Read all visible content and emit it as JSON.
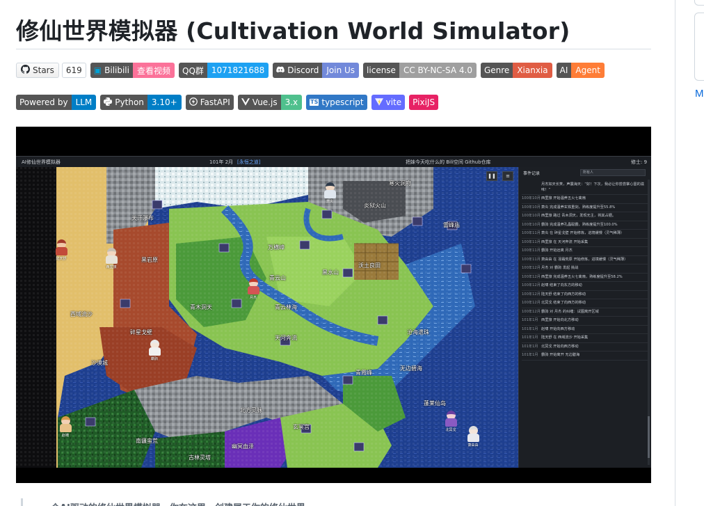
{
  "page": {
    "title": "修仙世界模拟器 (Cultivation World Simulator)",
    "sidebar_letter": "M",
    "quote_text": "一个AI驱动的修仙世界模拟器，你在这里，创建属于你的修仙世界"
  },
  "badges_row1": [
    {
      "type": "stars",
      "icon": "github-icon",
      "label": "Stars",
      "value": "619"
    },
    {
      "icon": "bilibili-icon",
      "label": "Bilibili",
      "value": "查看视频",
      "color": "#fb7299"
    },
    {
      "icon": "",
      "label": "QQ群",
      "value": "1071821688",
      "color": "#1da1f2"
    },
    {
      "icon": "discord-icon",
      "label": "Discord",
      "value": "Join Us",
      "color": "#7289da"
    },
    {
      "icon": "",
      "label": "license",
      "value": "CC BY-NC-SA 4.0",
      "color": "#9f9f9f"
    },
    {
      "icon": "",
      "label": "Genre",
      "value": "Xianxia",
      "color": "#e05d44"
    },
    {
      "icon": "",
      "label": "AI",
      "value": "Agent",
      "color": "#fe7d37"
    }
  ],
  "badges_row2": [
    {
      "icon": "",
      "label": "Powered by",
      "value": "LLM",
      "color": "#007ec6"
    },
    {
      "icon": "python-icon",
      "label": "Python",
      "value": "3.10+",
      "color": "#007ec6"
    },
    {
      "icon": "fastapi-icon",
      "label": "FastAPI",
      "value": "",
      "color": "#555555"
    },
    {
      "icon": "vue-icon",
      "label": "Vue.js",
      "value": "3.x",
      "color": "#4fc08d"
    },
    {
      "icon": "typescript-icon",
      "label": "typescript",
      "value": "",
      "color": "#3178c6"
    },
    {
      "icon": "vite-icon",
      "label": "vite",
      "value": "",
      "color": "#646cff"
    },
    {
      "icon": "",
      "label": "PixiJS",
      "value": "",
      "color": "#e72264"
    }
  ],
  "game": {
    "app_title": "AI修仙世界模拟器",
    "date": "101年 2月",
    "status": "[永恒之道]",
    "center_links": "把妹今天吃什么的 Bili空间 Github仓库",
    "right_count": "修士: 9",
    "panel_title": "事件记录",
    "panel_filter": "所有人",
    "log": [
      {
        "t": "",
        "m": "月杰如天长笑，声震海天：“好！下次，我必让你尝尝掌心雷的滋味！”"
      },
      {
        "t": "100年10月",
        "m": "西里旅 开始温养五火七禽扇"
      },
      {
        "t": "100年10月",
        "m": "萧炎 完成温养玄铁重剑，熟练度提升至55.8%"
      },
      {
        "t": "100年10月",
        "m": "西里旅 路过 青木洞天，发现无主，将其占据。"
      },
      {
        "t": "100年10月",
        "m": "霸驹 完成温养孔晶聪霸，熟练度提升至100.0%"
      },
      {
        "t": "100年11月",
        "m": "萧炎 在 碎星戈壁 开始修炼，进境缓慢（灵气稀薄）"
      },
      {
        "t": "100年11月",
        "m": "西里旅 在 天河奔流 开始采集"
      },
      {
        "t": "100年11月",
        "m": "霸驹 开始远离 月杰"
      },
      {
        "t": "100年11月",
        "m": "萧由由 在 凛霜荒原 开始修炼，进境缓慢（灵气稀薄）"
      },
      {
        "t": "100年12月",
        "m": "月杰 对 霸驹 发起 挑战"
      },
      {
        "t": "100年12月",
        "m": "西里旅 完成温养五火七禽扇，熟练度提升至58.2%"
      },
      {
        "t": "100年12月",
        "m": "赵啸 结束了向东方的移动"
      },
      {
        "t": "100年12月",
        "m": "陆天舒 结束了向西方的移动"
      },
      {
        "t": "100年12月",
        "m": "北冥戈 结束了向西方的移动"
      },
      {
        "t": "100年12月",
        "m": "霸驹 对 月杰 的纠缠：试图离开区域"
      },
      {
        "t": "101年1月",
        "m": "西里旅 开始向北方移动"
      },
      {
        "t": "101年1月",
        "m": "赵啸 开始向西方移动"
      },
      {
        "t": "101年1月",
        "m": "陆天舒 在 西域流沙 开始采集"
      },
      {
        "t": "101年1月",
        "m": "北冥戈 开始向西方移动"
      },
      {
        "t": "101年1月",
        "m": "霸驹 开始离开 无边碧海"
      }
    ],
    "map_labels": [
      {
        "id": "ice",
        "text": "寒火洞府"
      },
      {
        "id": "volcano",
        "text": "炎狱火山"
      },
      {
        "id": "tianhang",
        "text": "天汗瀑布"
      },
      {
        "id": "qingyun",
        "text": "青云山"
      },
      {
        "id": "wuheng",
        "text": "万横嶂"
      },
      {
        "id": "heishuishan",
        "text": "黑水山"
      },
      {
        "id": "wutu",
        "text": "沃土良田"
      },
      {
        "id": "yanhua",
        "text": "青云林海"
      },
      {
        "id": "qingmu",
        "text": "青木洞天"
      },
      {
        "id": "xiyu",
        "text": "西域流沙"
      },
      {
        "id": "suixing",
        "text": "碎星戈壁"
      },
      {
        "id": "shamo",
        "text": "沙漠城"
      },
      {
        "id": "tianhe",
        "text": "天河奔流"
      },
      {
        "id": "canghai",
        "text": "沧海遗珠"
      },
      {
        "id": "wubian",
        "text": "无边碧海"
      },
      {
        "id": "penglai",
        "text": "蓬莱仙岛"
      },
      {
        "id": "beifang",
        "text": "北方灵脉"
      },
      {
        "id": "nanjiang",
        "text": "南疆蛮荒"
      },
      {
        "id": "xuanming",
        "text": "玄冥宫"
      },
      {
        "id": "youming",
        "text": "幽冥血泽"
      },
      {
        "id": "qingxia",
        "text": "青霞峰"
      },
      {
        "id": "jinlu",
        "text": "古林灵塔"
      },
      {
        "id": "heiyan",
        "text": "黑岩原"
      },
      {
        "id": "leifeng",
        "text": "雷峰庙"
      }
    ],
    "npcs": [
      {
        "id": "n1",
        "name": "陆天舒"
      },
      {
        "id": "n2",
        "name": "西里旅"
      },
      {
        "id": "n3",
        "name": "月杰"
      },
      {
        "id": "n4",
        "name": "萧炎"
      },
      {
        "id": "n5",
        "name": "霸驹"
      },
      {
        "id": "n6",
        "name": "赵啸"
      },
      {
        "id": "n7",
        "name": "北冥戈"
      },
      {
        "id": "n8",
        "name": "萧由由"
      }
    ]
  }
}
